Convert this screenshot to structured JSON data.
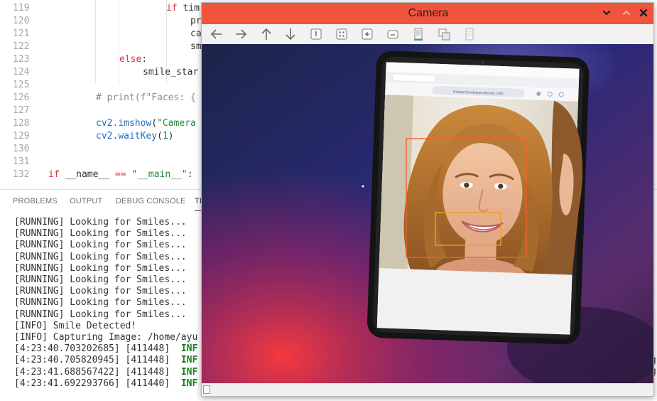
{
  "editor": {
    "lines": [
      {
        "num": "119",
        "indent": 234,
        "parts": [
          {
            "t": "if",
            "c": "kw"
          },
          {
            "t": " tim",
            "c": ""
          }
        ]
      },
      {
        "num": "120",
        "indent": 268,
        "parts": [
          {
            "t": "pr",
            "c": ""
          }
        ]
      },
      {
        "num": "121",
        "indent": 268,
        "parts": [
          {
            "t": "ca",
            "c": ""
          }
        ]
      },
      {
        "num": "122",
        "indent": 268,
        "parts": [
          {
            "t": "sm",
            "c": ""
          }
        ]
      },
      {
        "num": "123",
        "indent": 168,
        "parts": [
          {
            "t": "else",
            "c": "kw"
          },
          {
            "t": ":",
            "c": ""
          }
        ]
      },
      {
        "num": "124",
        "indent": 201,
        "parts": [
          {
            "t": "smile_star",
            "c": ""
          }
        ]
      },
      {
        "num": "125",
        "indent": 0,
        "parts": []
      },
      {
        "num": "126",
        "indent": 135,
        "parts": [
          {
            "t": "# print(f\"Faces: {",
            "c": "cm"
          }
        ]
      },
      {
        "num": "127",
        "indent": 0,
        "parts": []
      },
      {
        "num": "128",
        "indent": 135,
        "parts": [
          {
            "t": "cv2.",
            "c": "fn"
          },
          {
            "t": "imshow",
            "c": "fn"
          },
          {
            "t": "(",
            "c": ""
          },
          {
            "t": "\"Camera",
            "c": "str"
          }
        ]
      },
      {
        "num": "129",
        "indent": 135,
        "parts": [
          {
            "t": "cv2.",
            "c": "fn"
          },
          {
            "t": "waitKey",
            "c": "fn"
          },
          {
            "t": "(",
            "c": ""
          },
          {
            "t": "1",
            "c": "num"
          },
          {
            "t": ")",
            "c": ""
          }
        ]
      },
      {
        "num": "130",
        "indent": 0,
        "parts": []
      },
      {
        "num": "131",
        "indent": 0,
        "parts": []
      },
      {
        "num": "132",
        "indent": 68,
        "parts": [
          {
            "t": "if",
            "c": "kw"
          },
          {
            "t": " __name__ ",
            "c": ""
          },
          {
            "t": "==",
            "c": "kw"
          },
          {
            "t": " ",
            "c": ""
          },
          {
            "t": "\"__main__\"",
            "c": "str"
          },
          {
            "t": ":",
            "c": ""
          }
        ]
      }
    ]
  },
  "panel": {
    "tabs": [
      "PROBLEMS",
      "OUTPUT",
      "DEBUG CONSOLE",
      "TI"
    ],
    "active_tab": "TI",
    "terminal": [
      {
        "text": "[RUNNING] Looking for Smiles..."
      },
      {
        "text": "[RUNNING] Looking for Smiles..."
      },
      {
        "text": "[RUNNING] Looking for Smiles..."
      },
      {
        "text": "[RUNNING] Looking for Smiles..."
      },
      {
        "text": "[RUNNING] Looking for Smiles..."
      },
      {
        "text": "[RUNNING] Looking for Smiles..."
      },
      {
        "text": "[RUNNING] Looking for Smiles..."
      },
      {
        "text": "[RUNNING] Looking for Smiles..."
      },
      {
        "text": "[RUNNING] Looking for Smiles..."
      },
      {
        "text": "[INFO] Smile Detected!"
      },
      {
        "text": "[INFO] Capturing Image: /home/ayu"
      },
      {
        "text": "[4:23:40.703202685] [411448]  ",
        "tag": "INF"
      },
      {
        "text": "[4:23:40.705820945] [411448]  ",
        "tag": "INF"
      },
      {
        "text": "[4:23:41.688567422] [411448]  ",
        "tag": "INF"
      },
      {
        "text": "[4:23:41.692293766] [411440]  ",
        "tag": "INF"
      }
    ],
    "right_tail": [
      "g",
      "g"
    ]
  },
  "camera_window": {
    "title": "Camera",
    "titlebar_color": "#ef553d",
    "toolbar_icons": [
      "arrow-left-icon",
      "arrow-right-icon",
      "arrow-up-icon",
      "arrow-down-icon",
      "zoom-in-icon",
      "zoom-fit-icon",
      "zoom-out-icon",
      "zoom-original-icon",
      "save-image-icon",
      "copy-image-icon",
      "properties-icon"
    ],
    "viewport": {
      "tablet_url": "thispersondoesnotexist.com"
    }
  },
  "colors": {
    "keyword": "#d73a49",
    "function": "#1f6fbf",
    "string": "#22863a",
    "info": "#1a7f1a",
    "detection_box": "#f0632a"
  }
}
